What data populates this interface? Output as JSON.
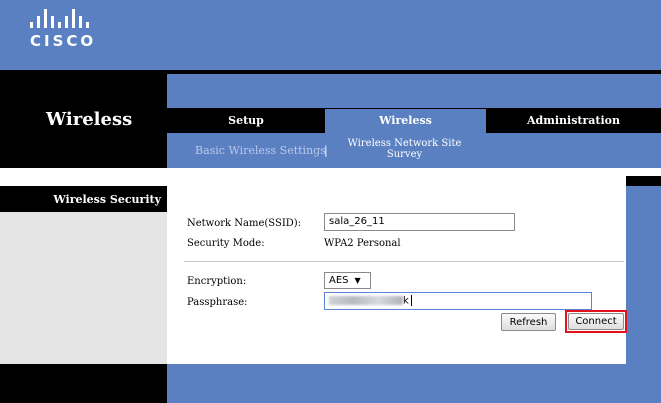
{
  "brand": {
    "logo_text": "CISCO"
  },
  "header": {
    "page_title": "Wireless"
  },
  "tabs": [
    {
      "label": "Setup"
    },
    {
      "label": "Wireless"
    },
    {
      "label": "Administration"
    }
  ],
  "subtabs": {
    "basic": "Basic Wireless Settings",
    "separator": "|",
    "survey_line1": "Wireless Network Site",
    "survey_line2": "Survey"
  },
  "section": {
    "title": "Wireless Security"
  },
  "form": {
    "ssid_label": "Network Name(SSID):",
    "ssid_value": "sala_26_11",
    "security_mode_label": "Security Mode:",
    "security_mode_value": "WPA2 Personal",
    "encryption_label": "Encryption:",
    "encryption_value": "AES",
    "encryption_arrow": "▼",
    "passphrase_label": "Passphrase:",
    "passphrase_suffix": "k"
  },
  "buttons": {
    "refresh": "Refresh",
    "connect": "Connect"
  },
  "colors": {
    "brand_blue": "#5b80c2",
    "highlight_red": "#e0121b",
    "black": "#000000"
  }
}
